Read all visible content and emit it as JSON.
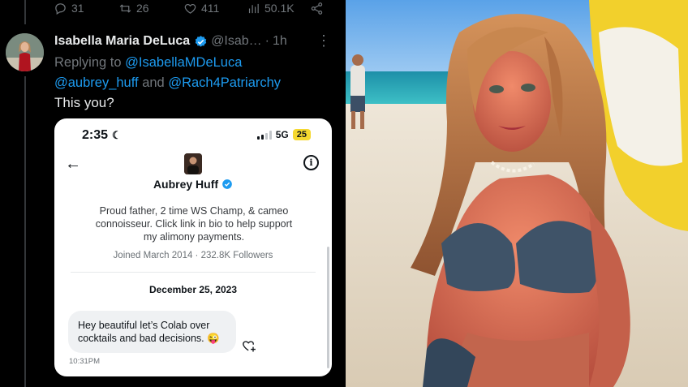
{
  "tweet": {
    "stats": {
      "replies": "31",
      "retweets": "26",
      "likes": "411",
      "views": "50.1K"
    },
    "author": {
      "name": "Isabella Maria DeLuca",
      "handle": "@Isab…",
      "time": "1h"
    },
    "replying_to": "Replying to",
    "mentions": [
      "@IsabellaMDeLuca",
      "@aubrey_huff",
      "@Rach4Patriarchy"
    ],
    "and_word": "and",
    "text": "This you?"
  },
  "embedded": {
    "status_time": "2:35",
    "network": "5G",
    "battery": "25",
    "profile_name": "Aubrey Huff",
    "bio": "Proud father, 2 time WS Champ, & cameo connoisseur. Click link in bio to help support my alimony payments.",
    "meta": "Joined March 2014 · 232.8K Followers",
    "date": "December 25, 2023",
    "message": "Hey beautiful let’s Colab over cocktails and bad decisions. 😜",
    "message_time": "10:31PM"
  },
  "colors": {
    "accent": "#1d9bf0",
    "muted": "#71767b",
    "text": "#e7e9ea"
  }
}
